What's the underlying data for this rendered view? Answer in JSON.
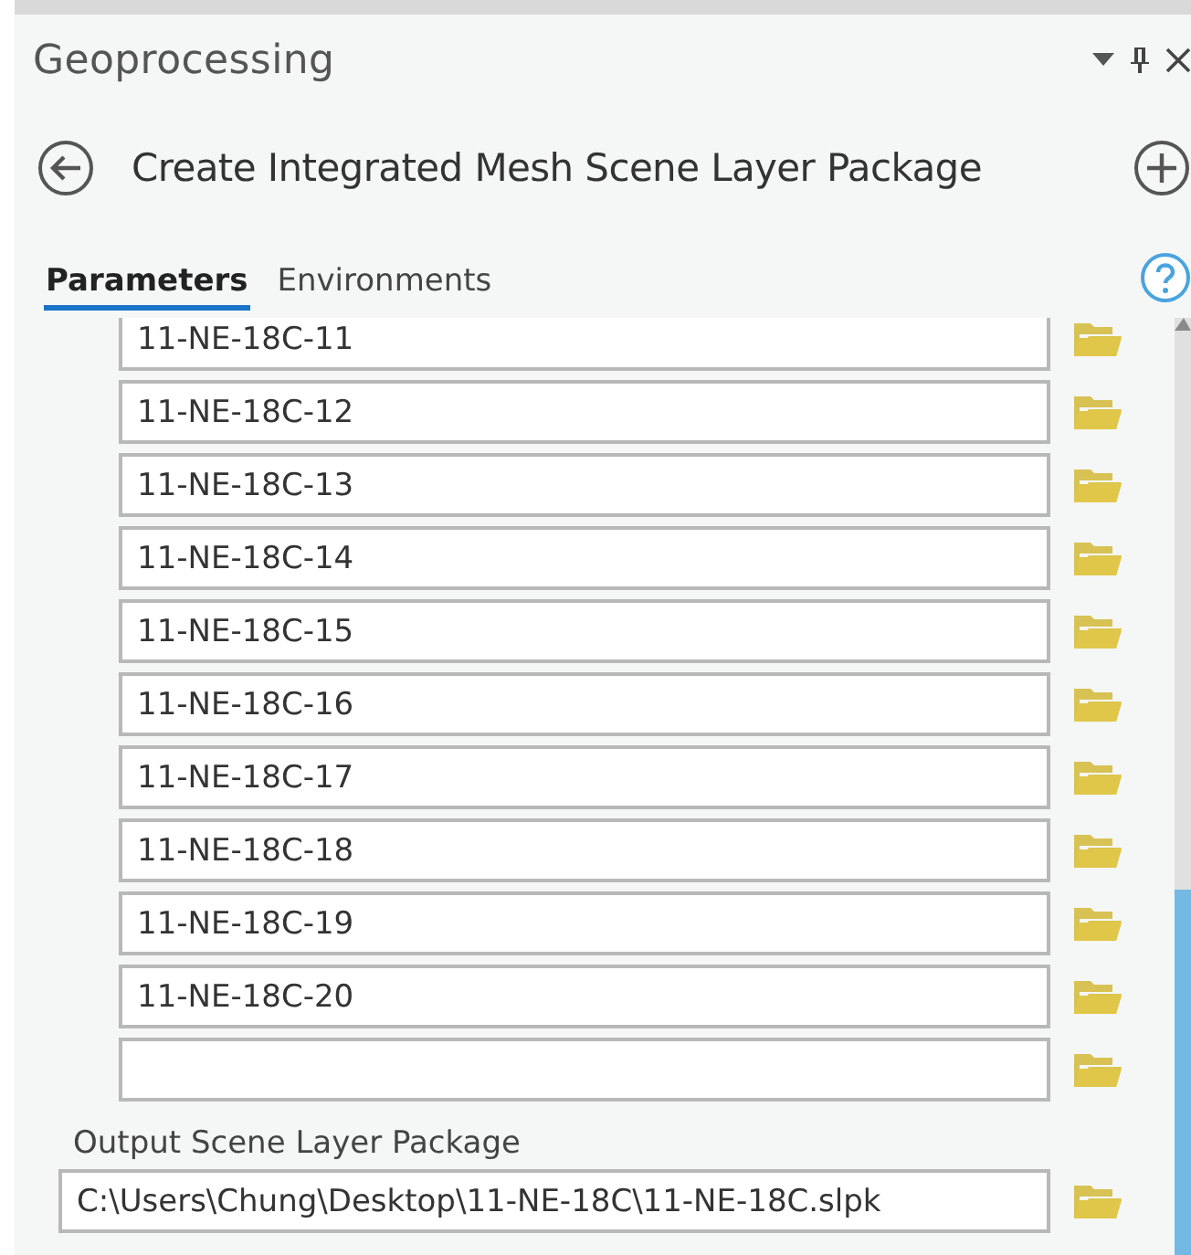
{
  "pane": {
    "title": "Geoprocessing"
  },
  "tool": {
    "title": "Create Integrated Mesh Scene Layer Package"
  },
  "tabs": [
    {
      "label": "Parameters",
      "selected": true
    },
    {
      "label": "Environments",
      "selected": false
    }
  ],
  "input_datasets": [
    {
      "kind": "filled",
      "value": "11-NE-18C-11"
    },
    {
      "kind": "filled",
      "value": "11-NE-18C-12"
    },
    {
      "kind": "filled",
      "value": "11-NE-18C-13"
    },
    {
      "kind": "filled",
      "value": "11-NE-18C-14"
    },
    {
      "kind": "filled",
      "value": "11-NE-18C-15"
    },
    {
      "kind": "filled",
      "value": "11-NE-18C-16"
    },
    {
      "kind": "filled",
      "value": "11-NE-18C-17"
    },
    {
      "kind": "filled",
      "value": "11-NE-18C-18"
    },
    {
      "kind": "filled",
      "value": "11-NE-18C-19"
    },
    {
      "kind": "filled",
      "value": "11-NE-18C-20"
    },
    {
      "kind": "blank"
    }
  ],
  "output": {
    "label": "Output Scene Layer Package",
    "value": "C:\\Users\\Chung\\Desktop\\11-NE-18C\\11-NE-18C.slpk"
  }
}
